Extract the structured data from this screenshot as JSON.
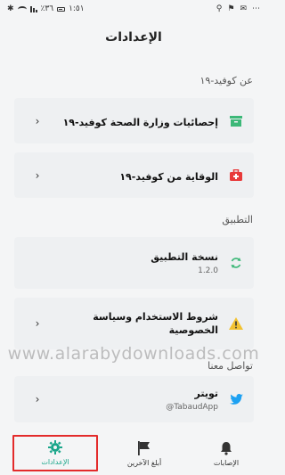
{
  "status_bar": {
    "time": "١:٥١",
    "right_glyphs": [
      "✆",
      "¥",
      "▲"
    ],
    "left_text": "٣٦٪"
  },
  "header": {
    "title": "الإعدادات"
  },
  "sections": {
    "covid": {
      "label": "عن كوفيد-١٩",
      "items": [
        {
          "title": "إحصائيات وزارة الصحة كوفيد-١٩",
          "icon": "archive-icon",
          "color": "#3cb878"
        },
        {
          "title": "الوقاية من كوفيد-١٩",
          "icon": "first-aid-kit-icon",
          "color": "#e83a3a"
        }
      ]
    },
    "app": {
      "label": "التطبيق",
      "items": [
        {
          "title": "نسخة التطبيق",
          "subtitle": "1.2.0",
          "icon": "sync-icon",
          "color": "#3cb878"
        },
        {
          "title": "شروط الاستخدام وسياسة الخصوصية",
          "icon": "warning-icon",
          "color": "#f2c230"
        }
      ]
    },
    "contact": {
      "label": "تواصل معنا",
      "items": [
        {
          "title": "تويتر",
          "subtitle": "@TabaudApp",
          "icon": "twitter-icon",
          "color": "#1da1f2"
        }
      ]
    }
  },
  "watermark": "www.alarabydownloads.com",
  "bottom_nav": {
    "settings": "الإعدادات",
    "notify_others": "أبلغ الآخرين",
    "exposures": "الإصابات"
  },
  "colors": {
    "accent": "#1aa68a",
    "highlight": "#e32b2b"
  }
}
